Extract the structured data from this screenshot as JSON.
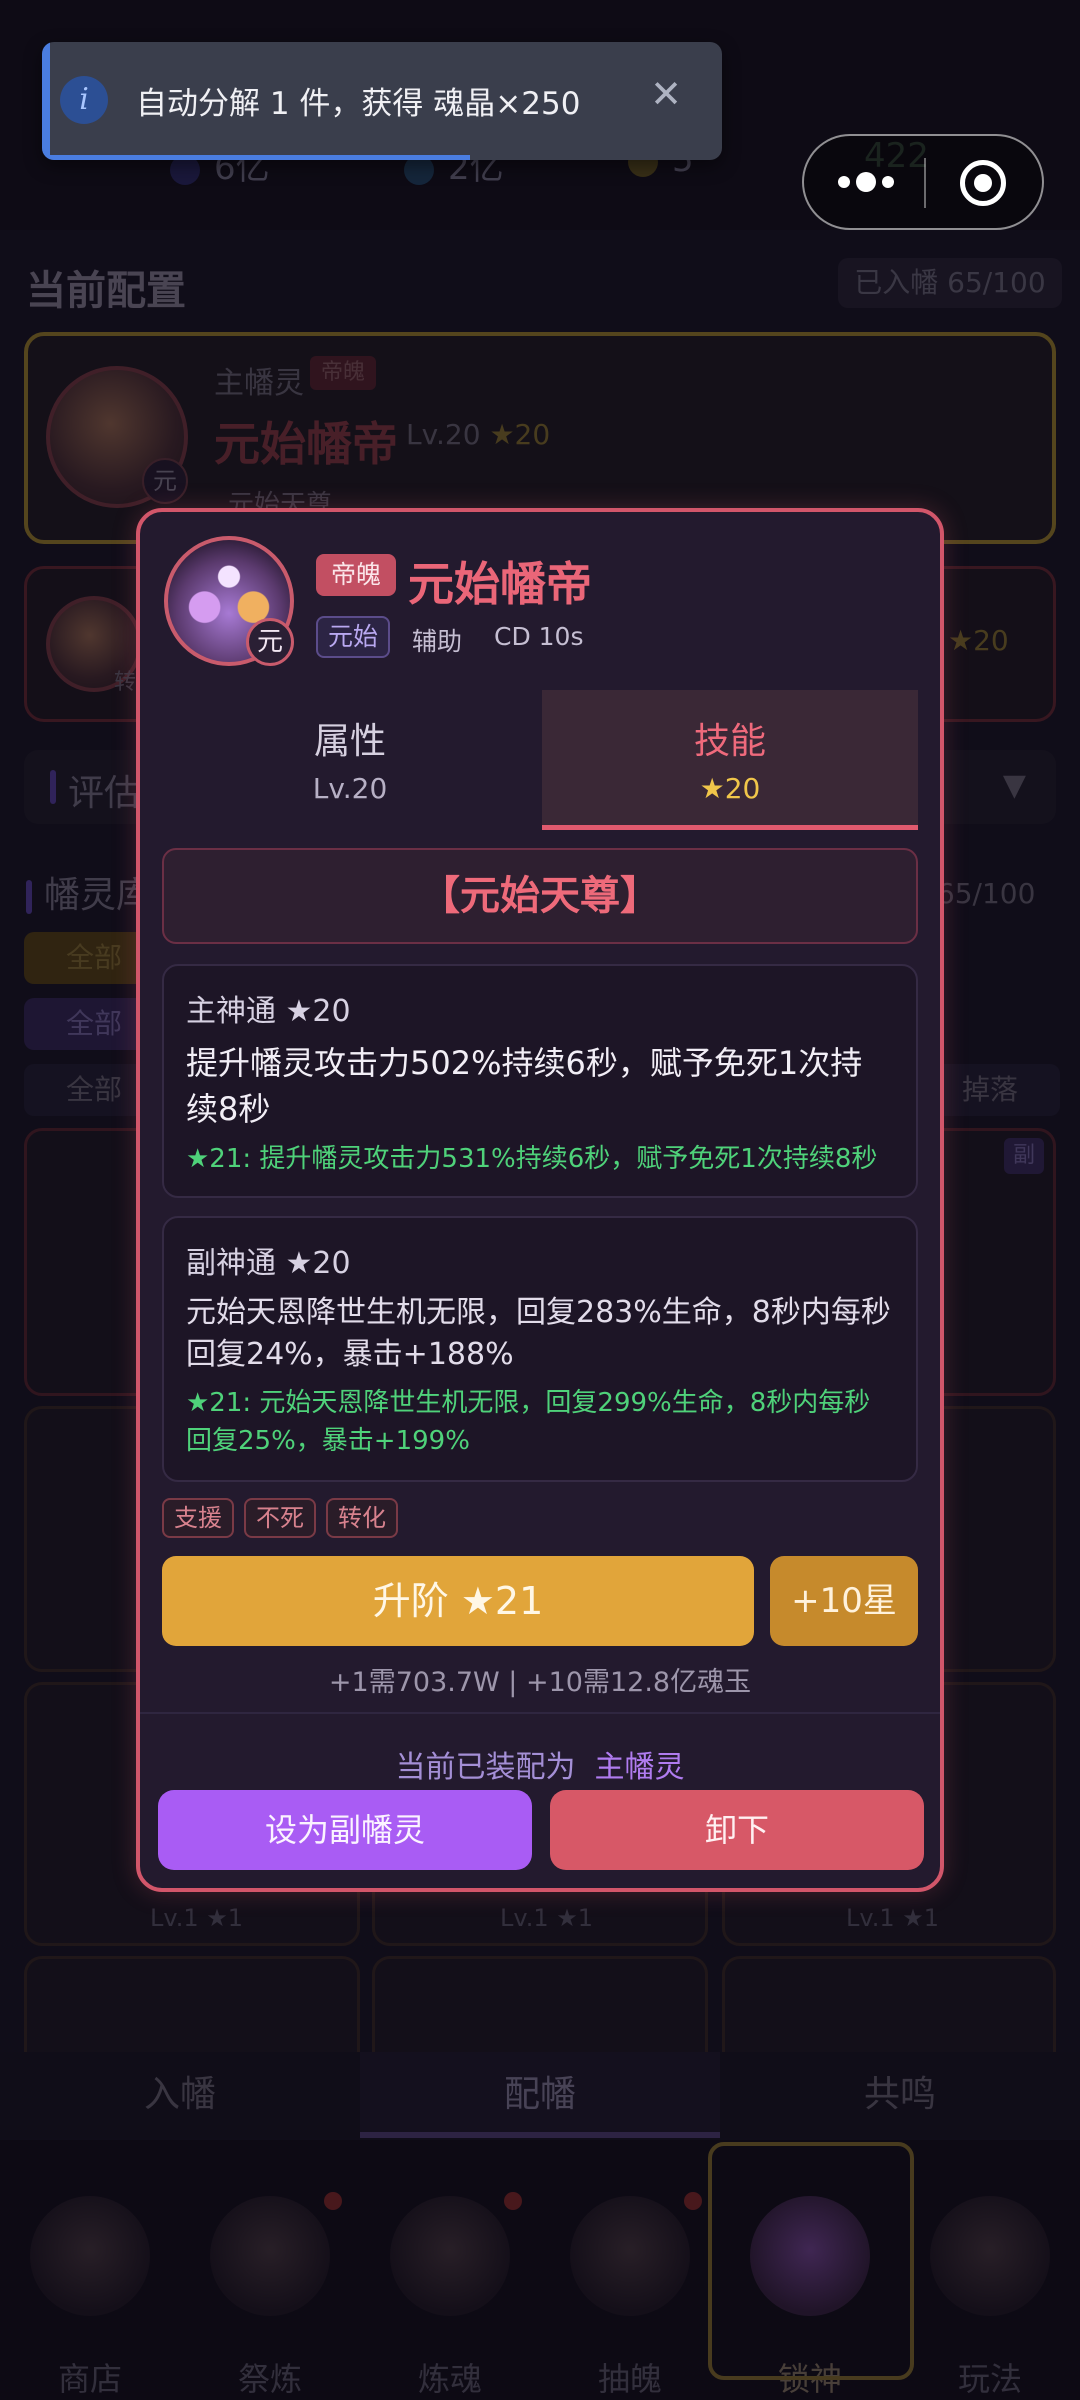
{
  "toast": {
    "message": "自动分解 1 件，获得 魂晶×250",
    "info_glyph": "i",
    "close_glyph": "✕"
  },
  "background": {
    "resources": [
      "6亿",
      "2亿",
      "5",
      "422"
    ],
    "section_title": "当前配置",
    "capacity": "已入幡 65/100",
    "main": {
      "role": "主幡灵",
      "tag": "帝魄",
      "name": "元始幡帝",
      "level": "Lv.20",
      "stars": "★20",
      "skill": "元始天尊",
      "badge": "元"
    },
    "second": {
      "badge": "转",
      "stars": "★20"
    },
    "eval_label": "评估",
    "roster_title": "幡灵库",
    "roster_count": "录 65/100",
    "filters": [
      "全部",
      "全部",
      "全部"
    ],
    "drop_label": "掉落",
    "sub_tag": "副",
    "cell_levels": [
      "Lv.1 ★1",
      "Lv.1 ★1",
      "Lv.1 ★1"
    ],
    "tabs": [
      "入幡",
      "配幡",
      "共鸣"
    ],
    "nav": [
      "商店",
      "祭炼",
      "炼魂",
      "抽魄",
      "锁神",
      "玩法"
    ]
  },
  "modal": {
    "tag": "帝魄",
    "name": "元始幡帝",
    "avatar_badge": "元",
    "faction": "元始",
    "role": "辅助",
    "cd": "CD 10s",
    "tabs": {
      "attr_label": "属性",
      "attr_sub": "Lv.20",
      "skill_label": "技能",
      "skill_sub": "★20"
    },
    "skill_name": "【元始天尊】",
    "main_skill": {
      "title": "主神通 ★20",
      "desc": "提升幡灵攻击力502%持续6秒，赋予免死1次持续8秒",
      "next": "★21: 提升幡灵攻击力531%持续6秒，赋予免死1次持续8秒"
    },
    "sub_skill": {
      "title": "副神通 ★20",
      "desc": "元始天恩降世生机无限，回复283%生命，8秒内每秒回复24%，暴击+188%",
      "next": "★21: 元始天恩降世生机无限，回复299%生命，8秒内每秒回复25%，暴击+199%"
    },
    "keywords": [
      "支援",
      "不死",
      "转化"
    ],
    "upgrade_label": "升阶 ★21",
    "ten_label": "+10星",
    "cost": "+1需703.7W | +10需12.8亿魂玉",
    "equipped_prefix": "当前已装配为",
    "equipped_value": "主幡灵",
    "set_sub_label": "设为副幡灵",
    "unequip_label": "卸下"
  },
  "colors": {
    "accent": "#d2566a",
    "gold": "#e1a53a",
    "purple": "#a95cf4",
    "green": "#4fd27a"
  }
}
